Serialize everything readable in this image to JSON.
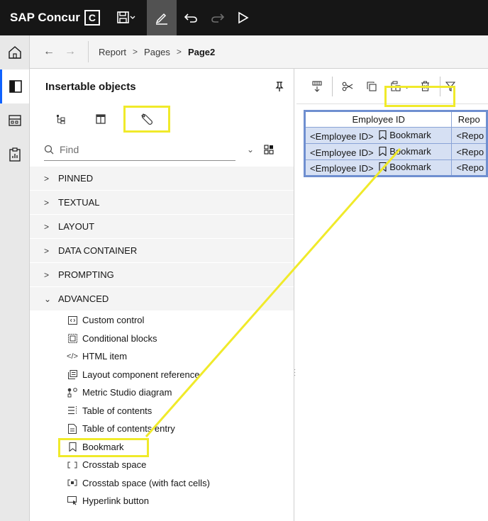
{
  "app": {
    "brand": "SAP Concur",
    "brand_box": "C"
  },
  "breadcrumb": {
    "items": [
      "Report",
      "Pages",
      "Page2"
    ]
  },
  "panel": {
    "title": "Insertable objects",
    "search_placeholder": "Find",
    "categories": [
      {
        "label": "PINNED",
        "expanded": false
      },
      {
        "label": "TEXTUAL",
        "expanded": false
      },
      {
        "label": "LAYOUT",
        "expanded": false
      },
      {
        "label": "DATA CONTAINER",
        "expanded": false
      },
      {
        "label": "PROMPTING",
        "expanded": false
      },
      {
        "label": "ADVANCED",
        "expanded": true
      }
    ],
    "advanced_items": [
      {
        "label": "Custom control",
        "icon": "custom-control-icon"
      },
      {
        "label": "Conditional blocks",
        "icon": "conditional-blocks-icon"
      },
      {
        "label": "HTML item",
        "icon": "html-item-icon"
      },
      {
        "label": "Layout component reference",
        "icon": "layout-component-icon"
      },
      {
        "label": "Metric Studio diagram",
        "icon": "metric-studio-icon"
      },
      {
        "label": "Table of contents",
        "icon": "table-of-contents-icon"
      },
      {
        "label": "Table of contents entry",
        "icon": "toc-entry-icon"
      },
      {
        "label": "Bookmark",
        "icon": "bookmark-icon"
      },
      {
        "label": "Crosstab space",
        "icon": "crosstab-space-icon"
      },
      {
        "label": "Crosstab space (with fact cells)",
        "icon": "crosstab-space-fact-icon"
      },
      {
        "label": "Hyperlink button",
        "icon": "hyperlink-button-icon"
      }
    ]
  },
  "report_table": {
    "headers": [
      "Employee ID",
      "Repo"
    ],
    "rows": [
      {
        "cell1": "<Employee ID>",
        "bookmark": "Bookmark",
        "cell2": "<Repo"
      },
      {
        "cell1": "<Employee ID>",
        "bookmark": "Bookmark",
        "cell2": "<Repo"
      },
      {
        "cell1": "<Employee ID>",
        "bookmark": "Bookmark",
        "cell2": "<Repo"
      }
    ]
  },
  "colors": {
    "topbar": "#161616",
    "highlight": "#f0ea2a",
    "accent": "#0f62fe",
    "table_border": "#6f8fd0"
  }
}
